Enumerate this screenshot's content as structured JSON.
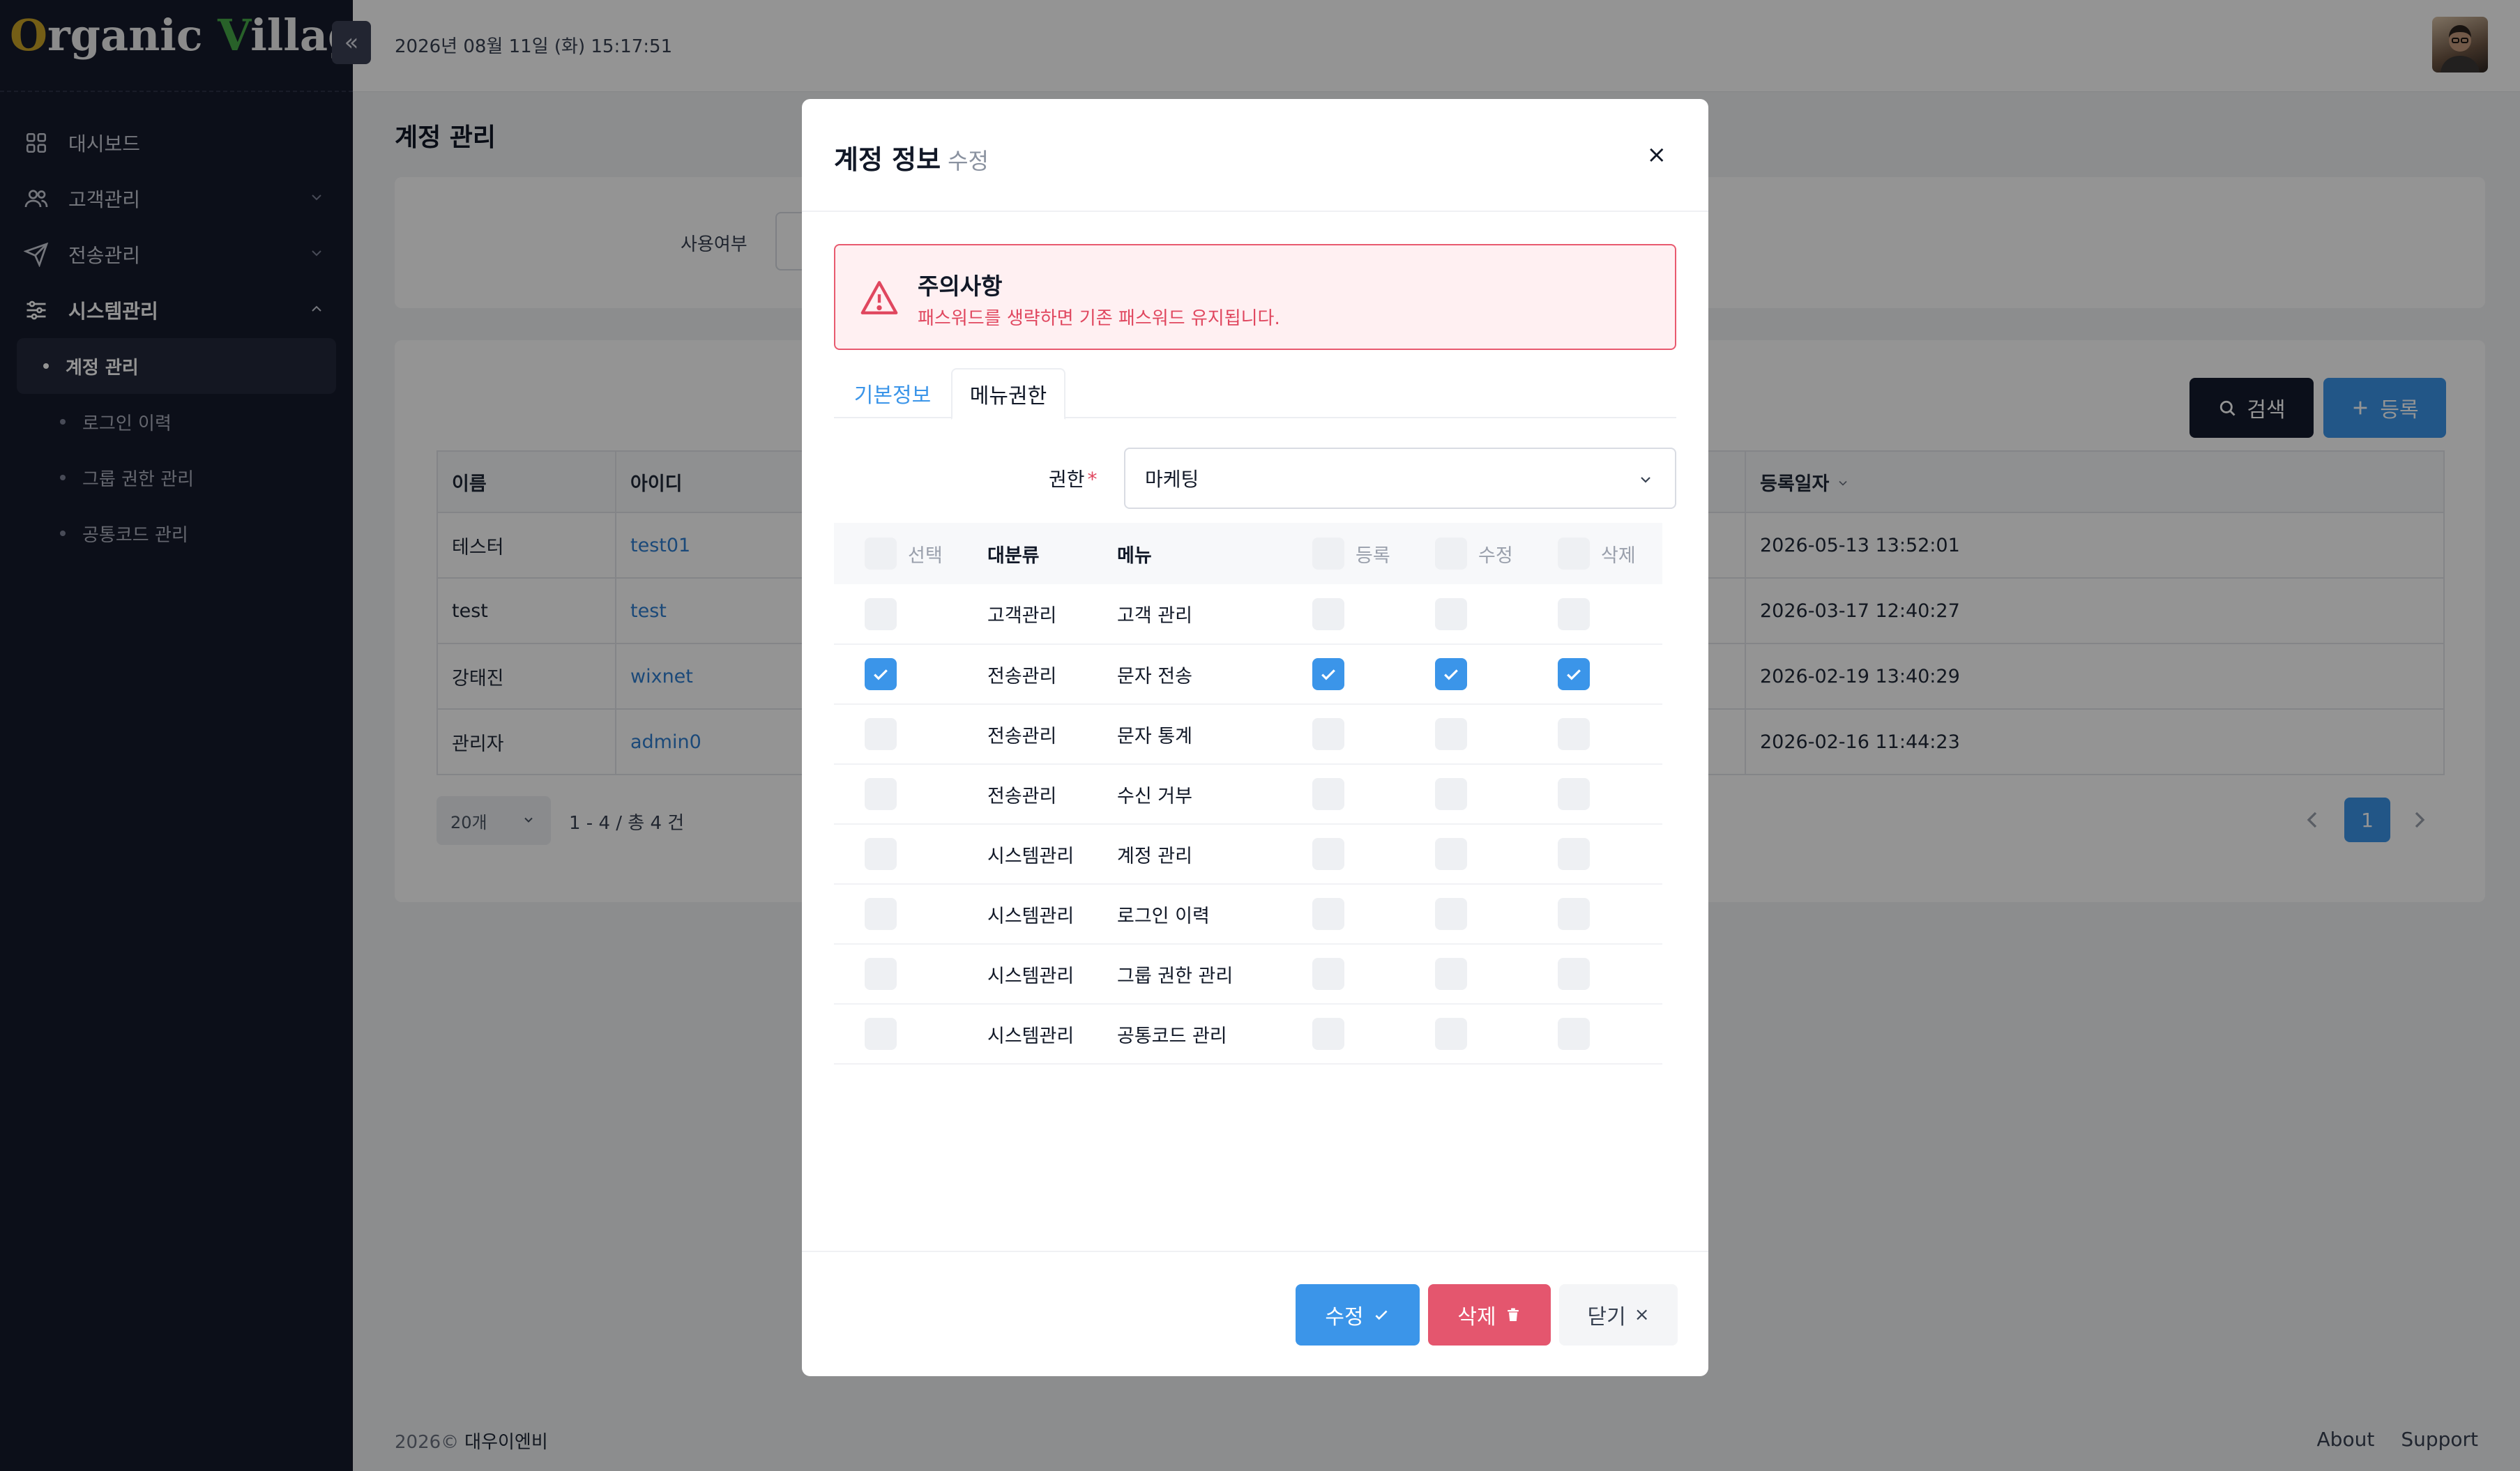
{
  "sidebar": {
    "logo": {
      "o": "O",
      "rest1": "rganic ",
      "v": "V",
      "rest2": "illages"
    },
    "collapse_symbol": "«",
    "nav": [
      {
        "label": "대시보드",
        "icon": "dashboard-icon"
      },
      {
        "label": "고객관리",
        "icon": "users-icon"
      },
      {
        "label": "전송관리",
        "icon": "send-icon"
      },
      {
        "label": "시스템관리",
        "icon": "settings-sliders-icon"
      }
    ],
    "subnav": [
      {
        "label": "계정 관리"
      },
      {
        "label": "로그인 이력"
      },
      {
        "label": "그룹 권한 관리"
      },
      {
        "label": "공통코드 관리"
      }
    ]
  },
  "topbar": {
    "datetime": "2026년 08월 11일 (화) 15:17:51"
  },
  "main": {
    "page_title": "계정 관리",
    "filter_label": "사용여부",
    "search_label": "검색",
    "register_label": "등록",
    "table": {
      "headers": [
        "이름",
        "아이디",
        "등록일자"
      ],
      "rows": [
        {
          "name": "테스터",
          "id": "test01",
          "date": "2026-05-13 13:52:01"
        },
        {
          "name": "test",
          "id": "test",
          "date": "2026-03-17 12:40:27"
        },
        {
          "name": "강태진",
          "id": "wixnet",
          "date": "2026-02-19 13:40:29"
        },
        {
          "name": "관리자",
          "id": "admin0",
          "date": "2026-02-16 11:44:23"
        }
      ]
    },
    "page_size": "20개",
    "pager_info": "1 - 4 / 총 4 건",
    "current_page": "1"
  },
  "footer": {
    "year": "2026©",
    "company": "대우이엔비",
    "about": "About",
    "support": "Support"
  },
  "modal": {
    "title": "계정 정보",
    "subtitle": "수정",
    "close_symbol": "×",
    "alert_title": "주의사항",
    "alert_text": "패스워드를 생략하면 기존 패스워드 유지됩니다.",
    "tabs": [
      "기본정보",
      "메뉴권한"
    ],
    "perm_label": "권한",
    "perm_required": "*",
    "perm_value": "마케팅",
    "perm_headers": {
      "select": "선택",
      "category": "대분류",
      "menu": "메뉴",
      "register": "등록",
      "modify": "수정",
      "delete": "삭제"
    },
    "perm_rows": [
      {
        "category": "고객관리",
        "menu": "고객 관리",
        "select": false,
        "register": false,
        "modify": false,
        "delete": false
      },
      {
        "category": "전송관리",
        "menu": "문자 전송",
        "select": true,
        "register": true,
        "modify": true,
        "delete": true
      },
      {
        "category": "전송관리",
        "menu": "문자 통계",
        "select": false,
        "register": false,
        "modify": false,
        "delete": false
      },
      {
        "category": "전송관리",
        "menu": "수신 거부",
        "select": false,
        "register": false,
        "modify": false,
        "delete": false
      },
      {
        "category": "시스템관리",
        "menu": "계정 관리",
        "select": false,
        "register": false,
        "modify": false,
        "delete": false
      },
      {
        "category": "시스템관리",
        "menu": "로그인 이력",
        "select": false,
        "register": false,
        "modify": false,
        "delete": false
      },
      {
        "category": "시스템관리",
        "menu": "그룹 권한 관리",
        "select": false,
        "register": false,
        "modify": false,
        "delete": false
      },
      {
        "category": "시스템관리",
        "menu": "공통코드 관리",
        "select": false,
        "register": false,
        "modify": false,
        "delete": false
      }
    ],
    "btn_edit": "수정",
    "btn_delete": "삭제",
    "btn_close": "닫기",
    "btn_close_symbol": "×"
  },
  "colors": {
    "primary": "#3b95e9",
    "danger": "#e4566e",
    "sidebar": "#161a2b",
    "dark_button": "#141a2e"
  }
}
